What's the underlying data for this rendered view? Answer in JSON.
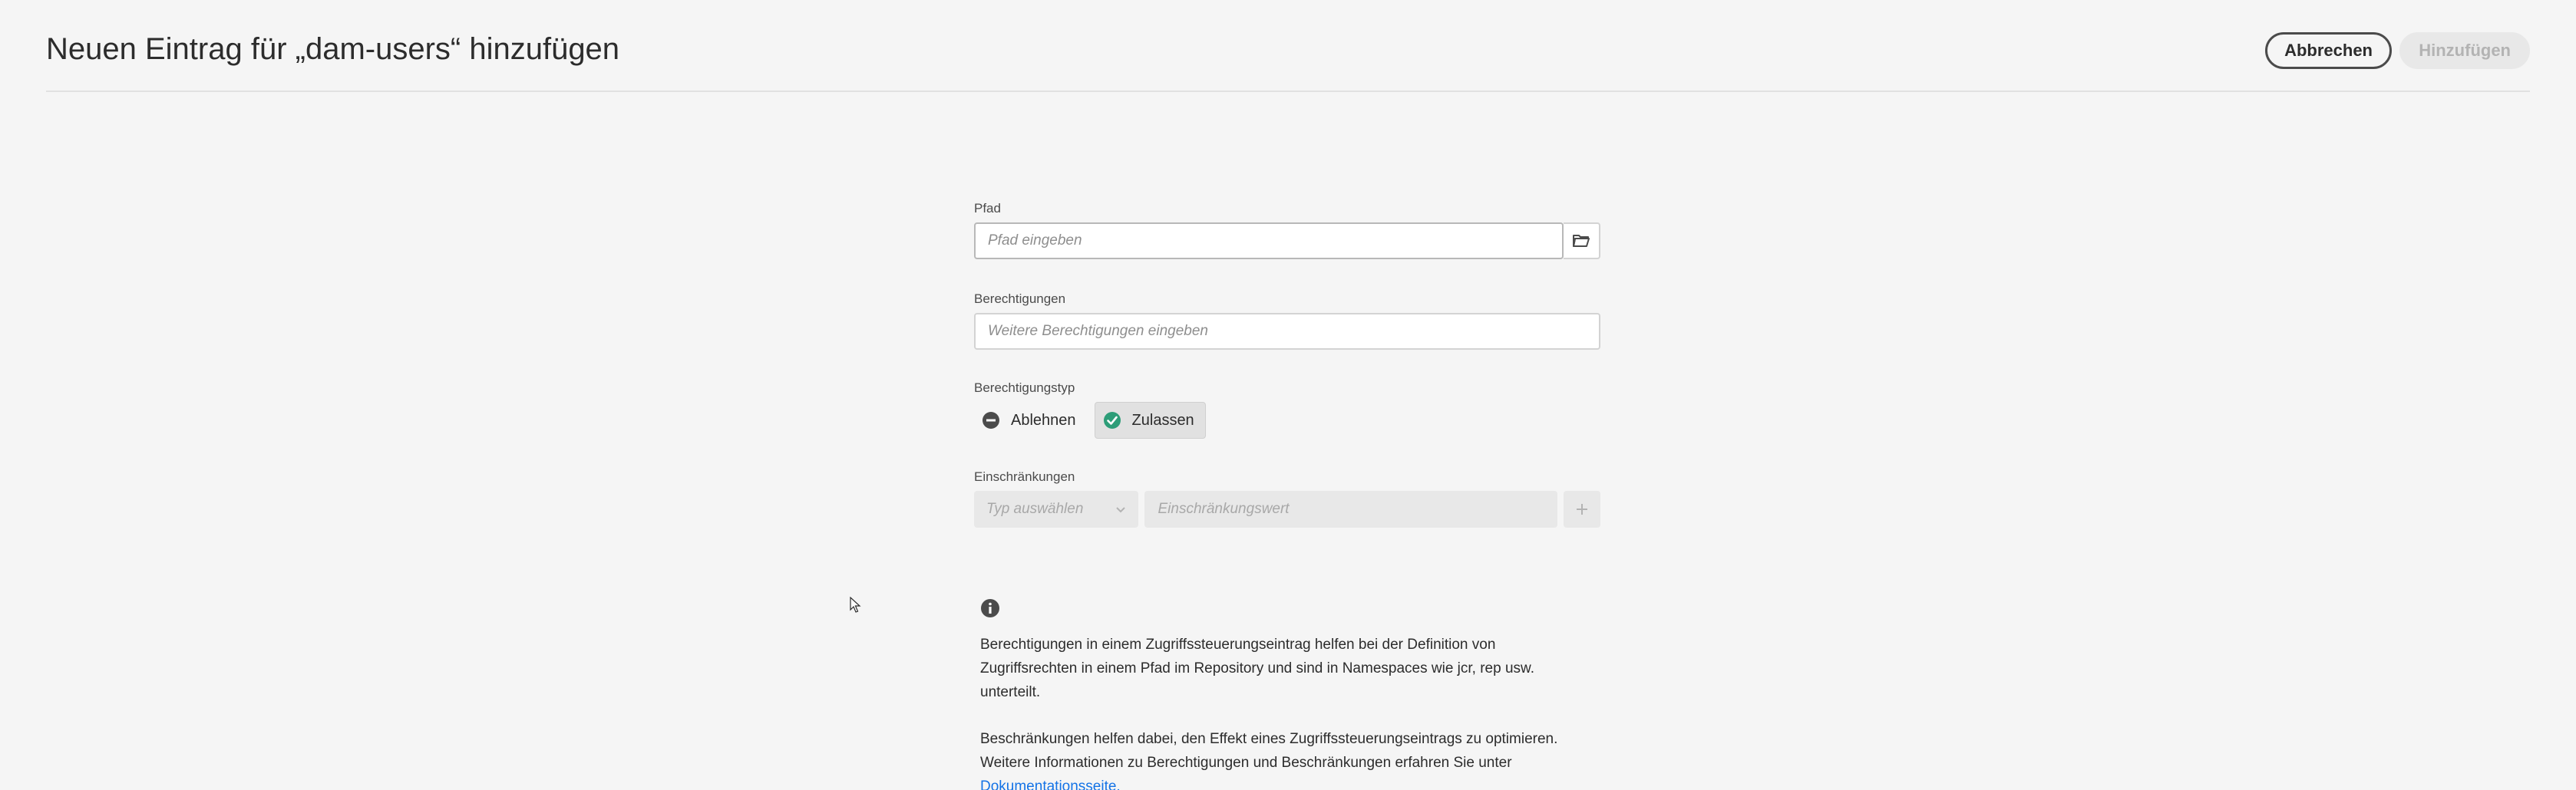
{
  "header": {
    "title": "Neuen Eintrag für „dam-users“ hinzufügen",
    "cancel_label": "Abbrechen",
    "add_label": "Hinzufügen"
  },
  "form": {
    "path": {
      "label": "Pfad",
      "value": "",
      "placeholder": "Pfad eingeben",
      "browse_icon": "folder-icon"
    },
    "permissions": {
      "label": "Berechtigungen",
      "value": "",
      "placeholder": "Weitere Berechtigungen eingeben"
    },
    "permission_type": {
      "label": "Berechtigungstyp",
      "options": [
        {
          "label": "Ablehnen",
          "icon": "deny-icon",
          "selected": false
        },
        {
          "label": "Zulassen",
          "icon": "check-circle-icon",
          "selected": true
        }
      ]
    },
    "restrictions": {
      "label": "Einschränkungen",
      "type_placeholder": "Typ auswählen",
      "value_placeholder": "Einschränkungswert",
      "add_icon": "plus-icon"
    }
  },
  "info": {
    "icon": "info-icon",
    "paragraph1": "Berechtigungen in einem Zugriffssteuerungseintrag helfen bei der Definition von Zugriffsrechten in einem Pfad im Repository und sind in Namespaces wie jcr, rep usw. unterteilt.",
    "paragraph2": "Beschränkungen helfen dabei, den Effekt eines Zugriffssteuerungseintrags zu optimieren. Weitere Informationen zu Berechtigungen und Beschränkungen erfahren Sie unter",
    "link_text": "Dokumentationsseite."
  },
  "colors": {
    "background": "#f5f5f5",
    "accent_green": "#2d9d78",
    "link_blue": "#1473e6",
    "text": "#2c2c2c"
  }
}
